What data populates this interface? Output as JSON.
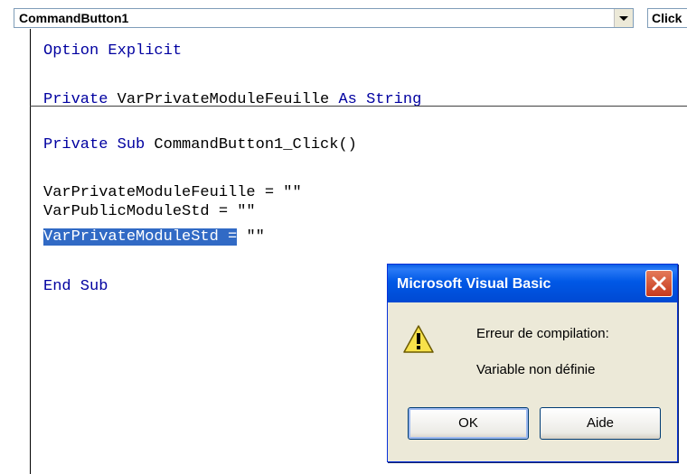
{
  "toolbar": {
    "object_combo_value": "CommandButton1",
    "procedure_combo_value": "Click"
  },
  "code": {
    "line1_kw": "Option Explicit",
    "line2_kw": "Private",
    "line2_rest": " VarPrivateModuleFeuille ",
    "line2_kw2": "As String",
    "line3_kw": "Private Sub",
    "line3_rest": " CommandButton1_Click()",
    "line4": "VarPrivateModuleFeuille = \"\"",
    "line5": "VarPublicModuleStd = \"\"",
    "line6_selected": "VarPrivateModuleStd =",
    "line6_rest": " \"\"",
    "line7_kw": "End Sub"
  },
  "dialog": {
    "title": "Microsoft Visual Basic",
    "message_line1": "Erreur de compilation:",
    "message_line2": "Variable non définie",
    "ok_label": "OK",
    "help_label": "Aide"
  },
  "icons": {
    "warning": "warning-icon",
    "close": "close-icon",
    "dropdown": "chevron-down-icon"
  },
  "colors": {
    "keyword": "#0000a0",
    "selection": "#316ac5",
    "titlebar": "#0058e6"
  }
}
